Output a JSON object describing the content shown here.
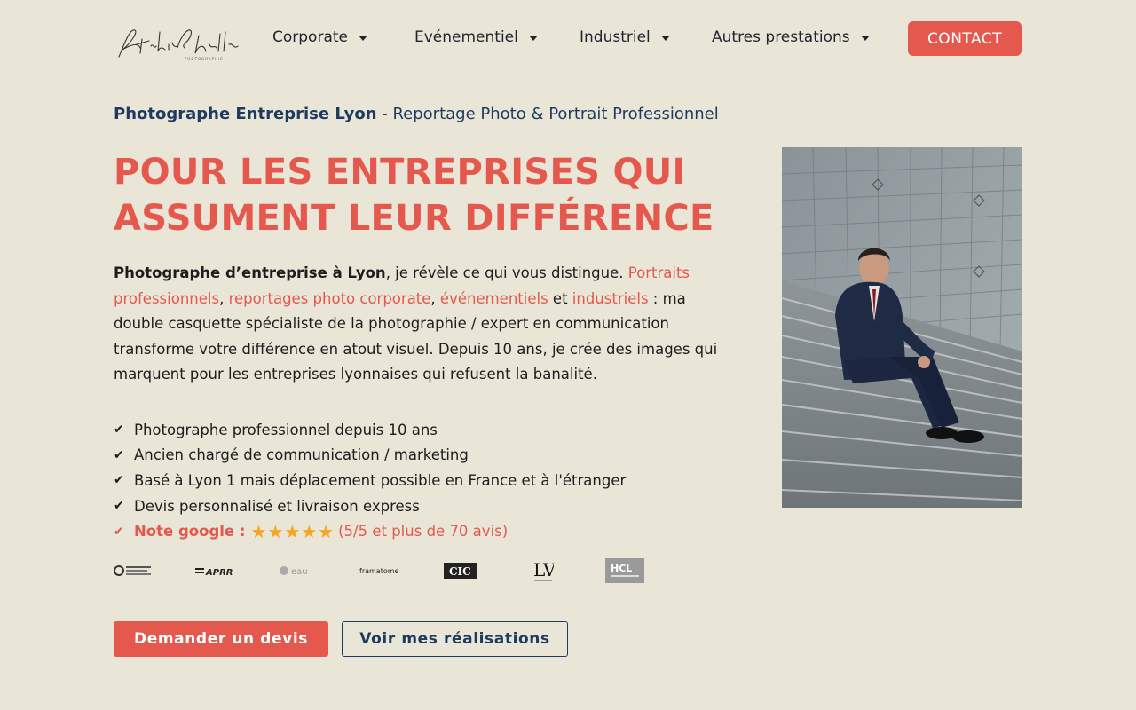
{
  "header": {
    "logo_alt": "Studio Chaillou Photographie",
    "nav": [
      {
        "label": "Corporate"
      },
      {
        "label": "Evénementiel"
      },
      {
        "label": "Industriel"
      },
      {
        "label": "Autres prestations"
      }
    ],
    "contact_label": "CONTACT"
  },
  "hero": {
    "subtitle_bold": "Photographe Entreprise Lyon",
    "subtitle_rest": " - Reportage Photo & Portrait Professionnel",
    "title_line1": "POUR LES ENTREPRISES QUI",
    "title_line2": "ASSUMENT LEUR DIFFÉRENCE",
    "intro": {
      "bold": "Photographe d’entreprise à Lyon",
      "t1": ", je révèle ce qui vous distingue. ",
      "link1": "Portraits professionnels",
      "t2": ", ",
      "link2": "reportages photo corporate",
      "t3": ", ",
      "link3": "événementiels",
      "t4": " et ",
      "link4": "industriels",
      "t5": " : ma double casquette spécialiste de la photographie / expert en communication transforme votre différence en atout visuel. Depuis 10 ans, je crée des images qui marquent pour les entreprises lyonnaises qui refusent la banalité."
    },
    "checklist": [
      "Photographe professionnel depuis 10 ans",
      "Ancien chargé de communication / marketing",
      "Basé à Lyon 1 mais déplacement possible en France et à l'étranger",
      "Devis personnalisé et livraison express"
    ],
    "rating": {
      "label": "Note google :",
      "stars": 5,
      "stars_text": "★★★★★",
      "summary": "(5/5 et plus de 70 avis)"
    },
    "client_logos": [
      "logo-chambre",
      "APRR",
      "eau",
      "framatome",
      "CIC",
      "LV",
      "HCL"
    ],
    "cta_primary": "Demander un devis",
    "cta_secondary": "Voir mes réalisations"
  },
  "colors": {
    "background": "#e9e6d7",
    "accent": "#e4584d",
    "navy": "#1e3a5f",
    "star": "#f5a623"
  }
}
